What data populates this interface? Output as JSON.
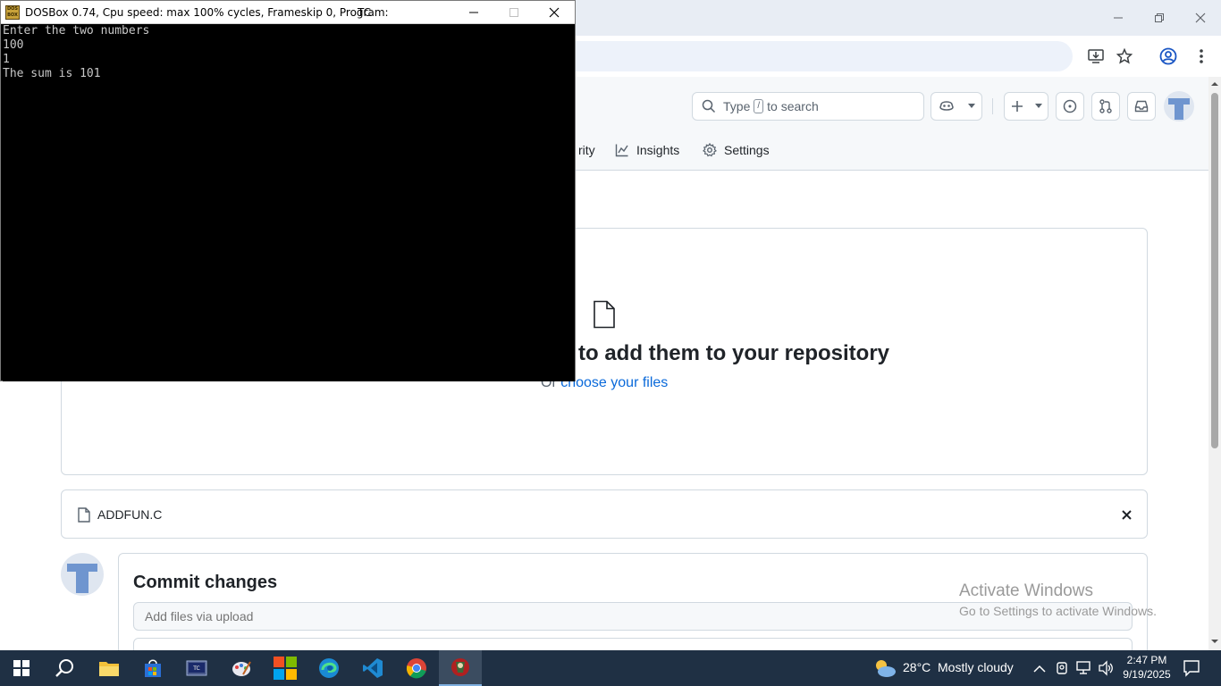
{
  "chrome": {
    "window_controls": [
      "minimize",
      "restore",
      "close"
    ]
  },
  "github": {
    "search_prefix": "Type",
    "search_key": "/",
    "search_suffix": "to search",
    "nav": {
      "security_partial": "rity",
      "insights": "Insights",
      "settings": "Settings"
    },
    "dropzone": {
      "title": "to add them to your repository",
      "sub_prefix": "Or",
      "sub_link": "choose your files"
    },
    "file": {
      "name": "ADDFUN.C"
    },
    "commit": {
      "heading": "Commit changes",
      "summary_placeholder": "Add files via upload"
    },
    "watermark": {
      "line1": "Activate Windows",
      "line2": "Go to Settings to activate Windows."
    }
  },
  "dosbox": {
    "icon_text": "DOS BOX",
    "title": "DOSBox 0.74, Cpu speed: max 100% cycles, Frameskip  0, Program:",
    "program": "TC",
    "lines": [
      "Enter the two numbers",
      "100",
      "1",
      "The sum is 101"
    ]
  },
  "taskbar": {
    "weather_temp": "28°C",
    "weather_desc": "Mostly cloudy",
    "time": "2:47 PM",
    "date": "9/19/2025"
  }
}
